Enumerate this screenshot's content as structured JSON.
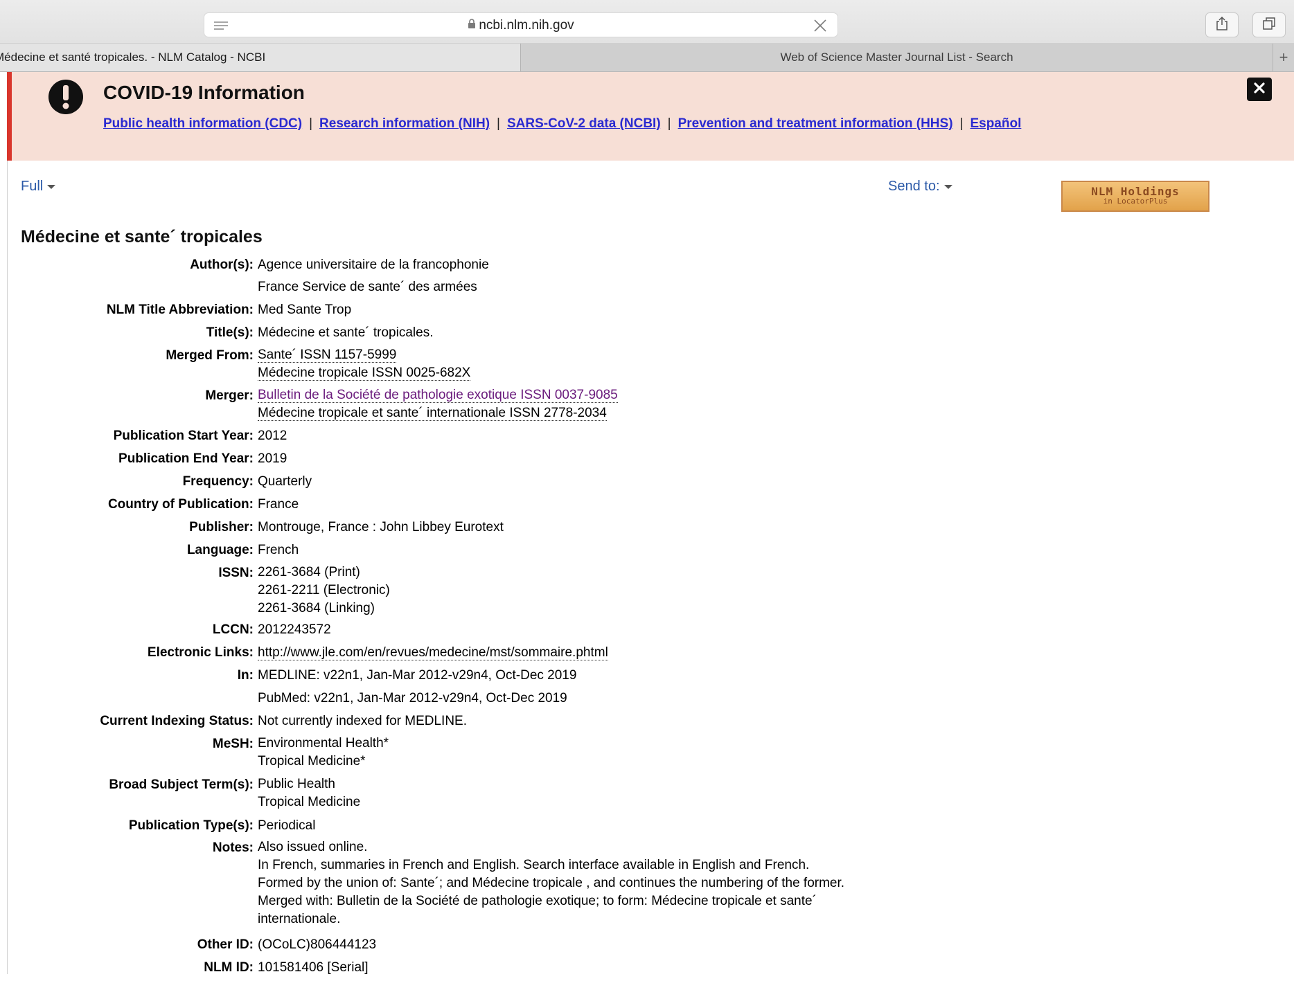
{
  "browser": {
    "url": "ncbi.nlm.nih.gov",
    "tabs": [
      {
        "label": "Médecine et santé tropicales. - NLM Catalog - NCBI",
        "active": true
      },
      {
        "label": "Web of Science Master Journal List - Search",
        "active": false
      }
    ],
    "new_tab": "+"
  },
  "banner": {
    "title": "COVID-19 Information",
    "links": [
      "Public health information (CDC)",
      "Research information (NIH)",
      "SARS-CoV-2 data (NCBI)",
      "Prevention and treatment information (HHS)",
      "Español"
    ],
    "separator": "|"
  },
  "controls": {
    "format_label": "Full",
    "send_label": "Send to:",
    "holdings_main": "NLM Holdings",
    "holdings_sub": "in LocatorPlus"
  },
  "record": {
    "title": "Médecine et sante´ tropicales",
    "fields": [
      {
        "label": "Author(s):",
        "values": [
          "Agence universitaire de la francophonie",
          "France Service de sante´ des armées"
        ]
      },
      {
        "label": "NLM Title Abbreviation:",
        "values": [
          "Med Sante Trop"
        ]
      },
      {
        "label": "Title(s):",
        "values": [
          "Médecine et sante´ tropicales."
        ]
      },
      {
        "label": "Merged From:",
        "values": [
          "Sante´ ISSN 1157-5999",
          "Médecine tropicale ISSN 0025-682X"
        ]
      },
      {
        "label": "Merger:",
        "values": [
          "Bulletin de la Société de pathologie exotique ISSN 0037-9085",
          "Médecine tropicale et sante´ internationale ISSN 2778-2034"
        ]
      },
      {
        "label": "Publication Start Year:",
        "values": [
          "2012"
        ]
      },
      {
        "label": "Publication End Year:",
        "values": [
          "2019"
        ]
      },
      {
        "label": "Frequency:",
        "values": [
          "Quarterly"
        ]
      },
      {
        "label": "Country of Publication:",
        "values": [
          "France"
        ]
      },
      {
        "label": "Publisher:",
        "values": [
          "Montrouge, France : John Libbey Eurotext"
        ]
      },
      {
        "label": "Language:",
        "values": [
          "French"
        ]
      },
      {
        "label": "ISSN:",
        "values": [
          "2261-3684 (Print)",
          "2261-2211 (Electronic)",
          "2261-3684 (Linking)"
        ]
      },
      {
        "label": "LCCN:",
        "values": [
          "2012243572"
        ]
      },
      {
        "label": "Electronic Links:",
        "values": [
          "http://www.jle.com/en/revues/medecine/mst/sommaire.phtml"
        ]
      },
      {
        "label": "In:",
        "values": [
          "MEDLINE: v22n1, Jan-Mar 2012-v29n4, Oct-Dec 2019",
          "PubMed: v22n1, Jan-Mar 2012-v29n4, Oct-Dec 2019"
        ]
      },
      {
        "label": "Current Indexing Status:",
        "values": [
          "Not currently indexed for MEDLINE."
        ]
      },
      {
        "label": "MeSH:",
        "values": [
          "Environmental Health*",
          "Tropical Medicine*"
        ]
      },
      {
        "label": "Broad Subject Term(s):",
        "values": [
          "Public Health",
          "Tropical Medicine"
        ]
      },
      {
        "label": "Publication Type(s):",
        "values": [
          "Periodical"
        ]
      },
      {
        "label": "Notes:",
        "values": [
          "Also issued online.",
          "In French, summaries in French and English. Search interface available in English and French.",
          "Formed by the union of: Sante´; and Médecine tropicale , and continues the numbering of the former.",
          "Merged with: Bulletin de la Société de pathologie exotique; to form: Médecine tropicale et sante´",
          "internationale."
        ]
      },
      {
        "label": "Other ID:",
        "values": [
          "(OCoLC)806444123"
        ]
      },
      {
        "label": "NLM ID:",
        "values": [
          "101581406 [Serial]"
        ]
      }
    ]
  },
  "colors": {
    "banner_bg": "#f7dfd6",
    "banner_accent": "#d9362c",
    "link_blue": "#2a2ad0",
    "visited_purple": "#6a1b7c"
  }
}
